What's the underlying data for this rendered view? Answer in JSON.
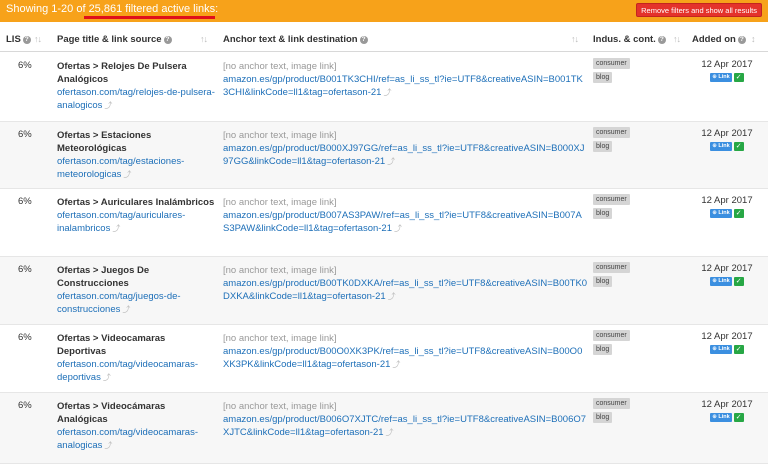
{
  "topbar": {
    "summary_prefix": "Showing 1-20 of ",
    "summary_highlight": "25,861 filtered active links:",
    "remove_button": "Remove filters and show all results"
  },
  "columns": {
    "lis": "LIS",
    "page": "Page title & link source",
    "anchor": "Anchor text & link destination",
    "industry": "Indus. & cont.",
    "added": "Added on"
  },
  "rows": [
    {
      "lis": "6%",
      "title": "Ofertas > Relojes De Pulsera Analógicos",
      "source": "ofertason.com/tag/relojes-de-pulsera-analogicos",
      "anchor": "[no anchor text, image link]",
      "dest": "amazon.es/gp/product/B001TK3CHI/ref=as_li_ss_tl?ie=UTF8&creativeASIN=B001TK3CHI&linkCode=ll1&tag=ofertason-21",
      "tags": [
        "consumer",
        "blog"
      ],
      "added": "12 Apr 2017",
      "badge": "Link"
    },
    {
      "lis": "6%",
      "title": "Ofertas > Estaciones Meteorológicas",
      "source": "ofertason.com/tag/estaciones-meteorologicas",
      "anchor": "[no anchor text, image link]",
      "dest": "amazon.es/gp/product/B000XJ97GG/ref=as_li_ss_tl?ie=UTF8&creativeASIN=B000XJ97GG&linkCode=ll1&tag=ofertason-21",
      "tags": [
        "consumer",
        "blog"
      ],
      "added": "12 Apr 2017",
      "badge": "Link"
    },
    {
      "lis": "6%",
      "title": "Ofertas > Auriculares Inalámbricos",
      "source": "ofertason.com/tag/auriculares-inalambricos",
      "anchor": "[no anchor text, image link]",
      "dest": "amazon.es/gp/product/B007AS3PAW/ref=as_li_ss_tl?ie=UTF8&creativeASIN=B007AS3PAW&linkCode=ll1&tag=ofertason-21",
      "tags": [
        "consumer",
        "blog"
      ],
      "added": "12 Apr 2017",
      "badge": "Link"
    },
    {
      "lis": "6%",
      "title": "Ofertas > Juegos De Construcciones",
      "source": "ofertason.com/tag/juegos-de-construcciones",
      "anchor": "[no anchor text, image link]",
      "dest": "amazon.es/gp/product/B00TK0DXKA/ref=as_li_ss_tl?ie=UTF8&creativeASIN=B00TK0DXKA&linkCode=ll1&tag=ofertason-21",
      "tags": [
        "consumer",
        "blog"
      ],
      "added": "12 Apr 2017",
      "badge": "Link"
    },
    {
      "lis": "6%",
      "title": "Ofertas > Videocamaras Deportivas",
      "source": "ofertason.com/tag/videocamaras-deportivas",
      "anchor": "[no anchor text, image link]",
      "dest": "amazon.es/gp/product/B00O0XK3PK/ref=as_li_ss_tl?ie=UTF8&creativeASIN=B00O0XK3PK&linkCode=ll1&tag=ofertason-21",
      "tags": [
        "consumer",
        "blog"
      ],
      "added": "12 Apr 2017",
      "badge": "Link"
    },
    {
      "lis": "6%",
      "title": "Ofertas > Videocámaras Analógicas",
      "source": "ofertason.com/tag/videocamaras-analogicas",
      "anchor": "[no anchor text, image link]",
      "dest": "amazon.es/gp/product/B006O7XJTC/ref=as_li_ss_tl?ie=UTF8&creativeASIN=B006O7XJTC&linkCode=ll1&tag=ofertason-21",
      "tags": [
        "consumer",
        "blog"
      ],
      "added": "12 Apr 2017",
      "badge": "Link"
    }
  ]
}
